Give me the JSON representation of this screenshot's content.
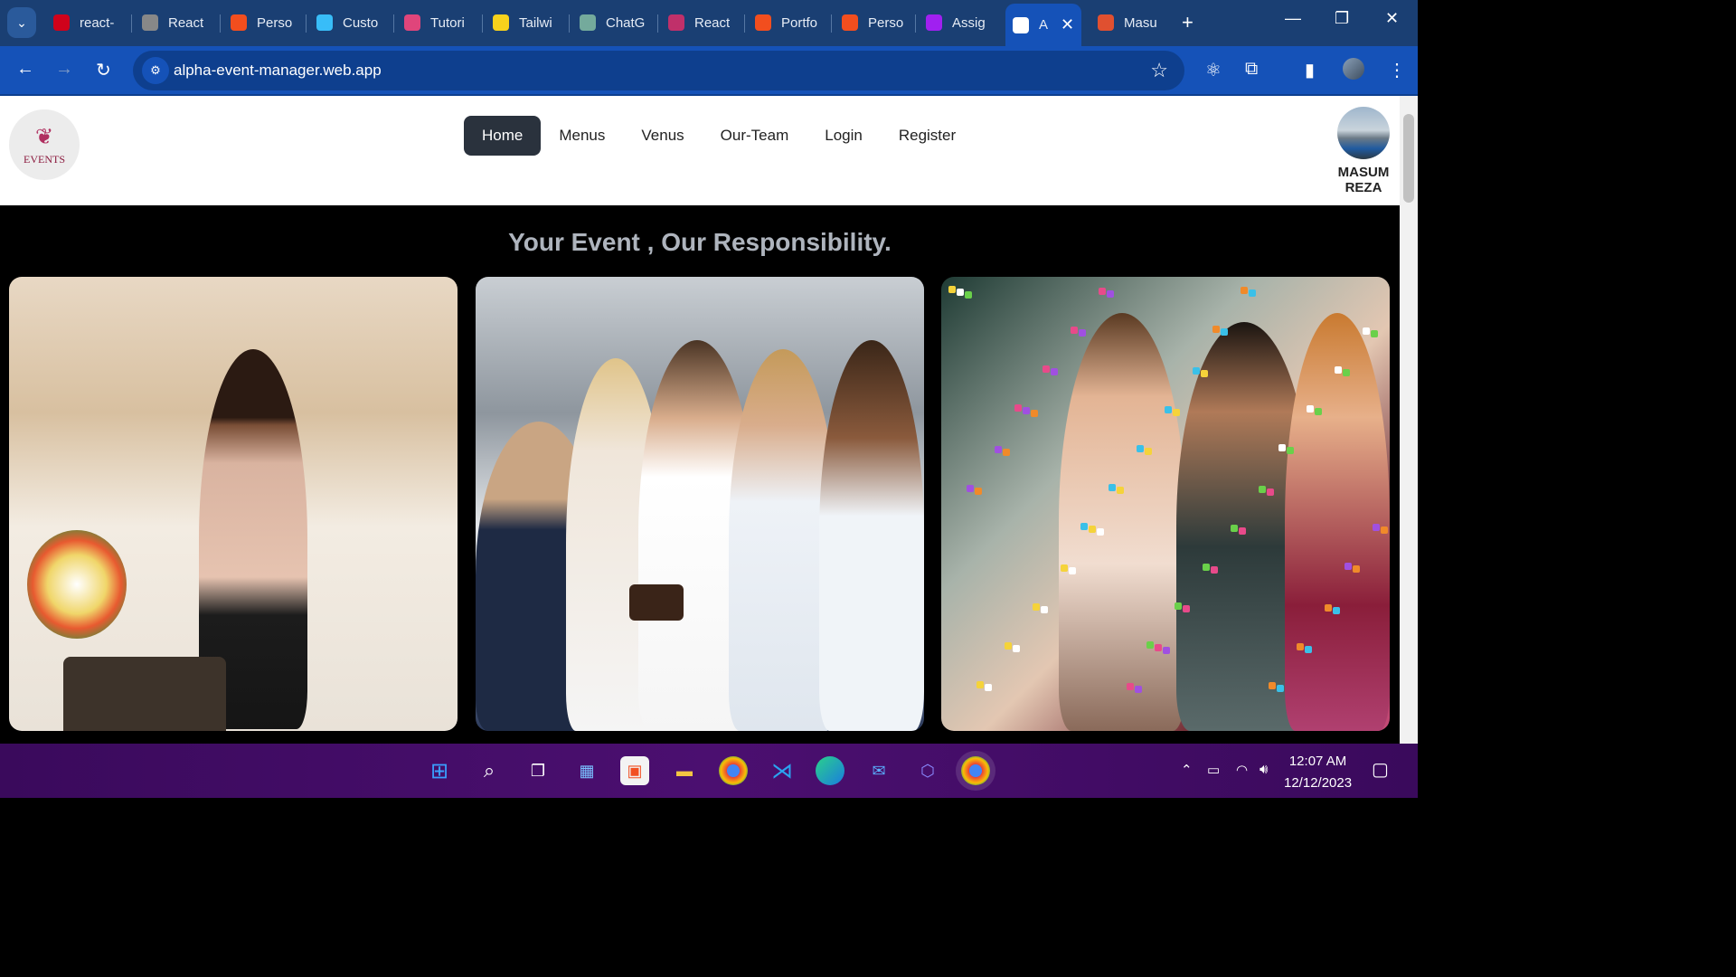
{
  "browser": {
    "tabs": [
      {
        "label": "react-",
        "icon": "n-box-icon",
        "color": "#d0021b"
      },
      {
        "label": "React",
        "icon": "globe-icon",
        "color": "#888888"
      },
      {
        "label": "Perso",
        "icon": "figma-icon",
        "color": "#f24e1e"
      },
      {
        "label": "Custo",
        "icon": "tailwind-icon",
        "color": "#38bdf8"
      },
      {
        "label": "Tutori",
        "icon": "dots-icon",
        "color": "#e0457b"
      },
      {
        "label": "Tailwi",
        "icon": "bulb-icon",
        "color": "#f7d21c"
      },
      {
        "label": "ChatG",
        "icon": "openai-icon",
        "color": "#74aa9c"
      },
      {
        "label": "React",
        "icon": "react-icon",
        "color": "#c0306a"
      },
      {
        "label": "Portfo",
        "icon": "figma-icon",
        "color": "#f24e1e"
      },
      {
        "label": "Perso",
        "icon": "figma-icon",
        "color": "#f24e1e"
      },
      {
        "label": "Assig",
        "icon": "play-icon",
        "color": "#a020f0"
      },
      {
        "label": "A",
        "icon": "events-icon",
        "color": "#ffffff",
        "active": true
      },
      {
        "label": "Masu",
        "icon": "chrome-profile-icon",
        "color": "#e05030"
      }
    ],
    "url": "alpha-event-manager.web.app"
  },
  "site": {
    "logo_text": "EVENTS",
    "nav": [
      "Home",
      "Menus",
      "Venus",
      "Our-Team",
      "Login",
      "Register"
    ],
    "active_nav": "Home",
    "user_name_line1": "MASUM",
    "user_name_line2": "REZA",
    "banner_title": "Your Event , Our Responsibility."
  },
  "taskbar": {
    "time": "12:07 AM",
    "date": "12/12/2023"
  }
}
